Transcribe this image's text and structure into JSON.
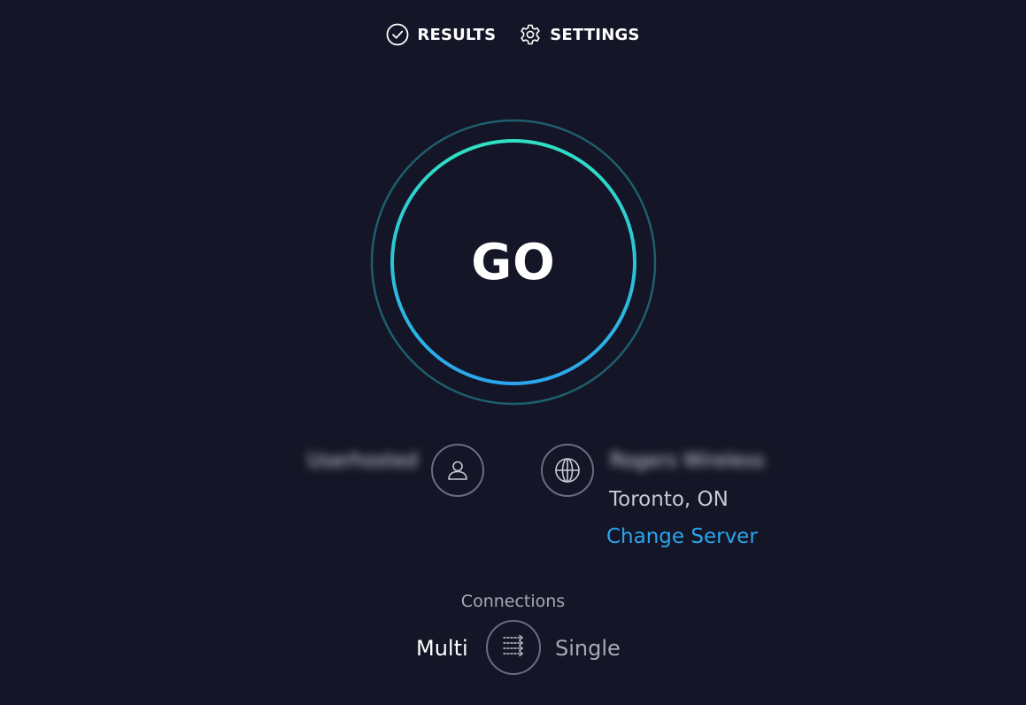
{
  "nav": {
    "results_label": "RESULTS",
    "settings_label": "SETTINGS"
  },
  "go": {
    "label": "GO"
  },
  "provider": {
    "isp_name": "Userhosted",
    "server_name": "Rogers Wireless",
    "server_location": "Toronto, ON",
    "change_server_label": "Change Server"
  },
  "connections": {
    "label": "Connections",
    "multi_label": "Multi",
    "single_label": "Single",
    "selected": "Multi"
  },
  "icons": {
    "results": "check-circle-icon",
    "settings": "gear-icon",
    "user": "user-icon",
    "globe": "globe-icon",
    "connections": "multi-arrows-icon"
  },
  "colors": {
    "background": "#141526",
    "ring_gradient_start": "#2fe0c4",
    "ring_gradient_end": "#2aa6ee",
    "outer_ring": "#1e5f6d",
    "link": "#2aa6ee"
  }
}
